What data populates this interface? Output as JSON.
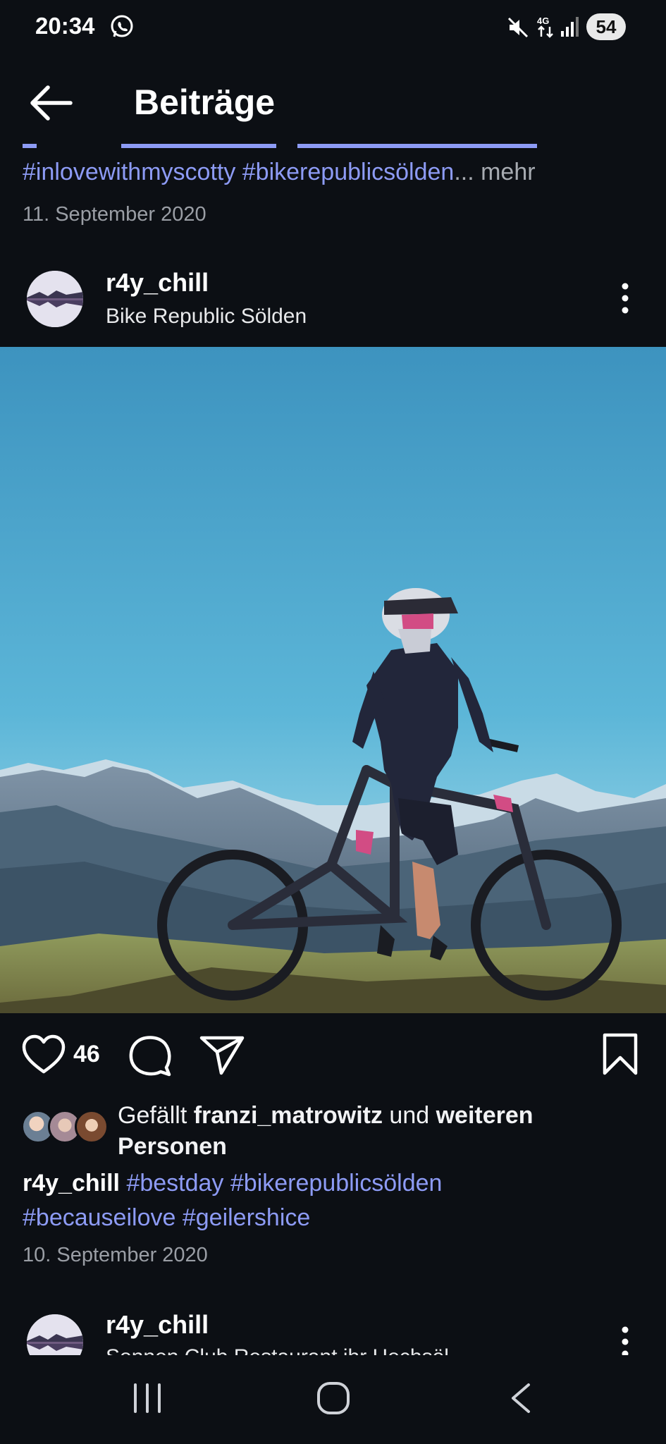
{
  "status_bar": {
    "time": "20:34",
    "battery": "54",
    "network": "4G"
  },
  "header": {
    "title": "Beiträge"
  },
  "previous_post": {
    "hashtags": "#inlovewithmyscotty #bikerepublicsölden",
    "more_label": "... mehr",
    "date": "11. September 2020"
  },
  "post": {
    "username": "r4y_chill",
    "location": "Bike Republic Sölden",
    "like_count": "46",
    "liked_by_prefix": "Gefällt ",
    "liked_by_user": "franzi_matrowitz",
    "liked_by_and": " und ",
    "liked_by_suffix": "weiteren Personen",
    "caption_user": "r4y_chill",
    "caption_tags": [
      "#bestday",
      "#bikerepublicsölden",
      "#becauseilove",
      "#geilershice"
    ],
    "date": "10. September 2020"
  },
  "next_post": {
    "username": "r4y_chill",
    "location_partial": "Sonnen Club Restaurant ihr Hochsöl"
  },
  "colors": {
    "background": "#0c0f14",
    "hashtag": "#8d9bf5",
    "secondary_text": "#9a9ea5"
  }
}
